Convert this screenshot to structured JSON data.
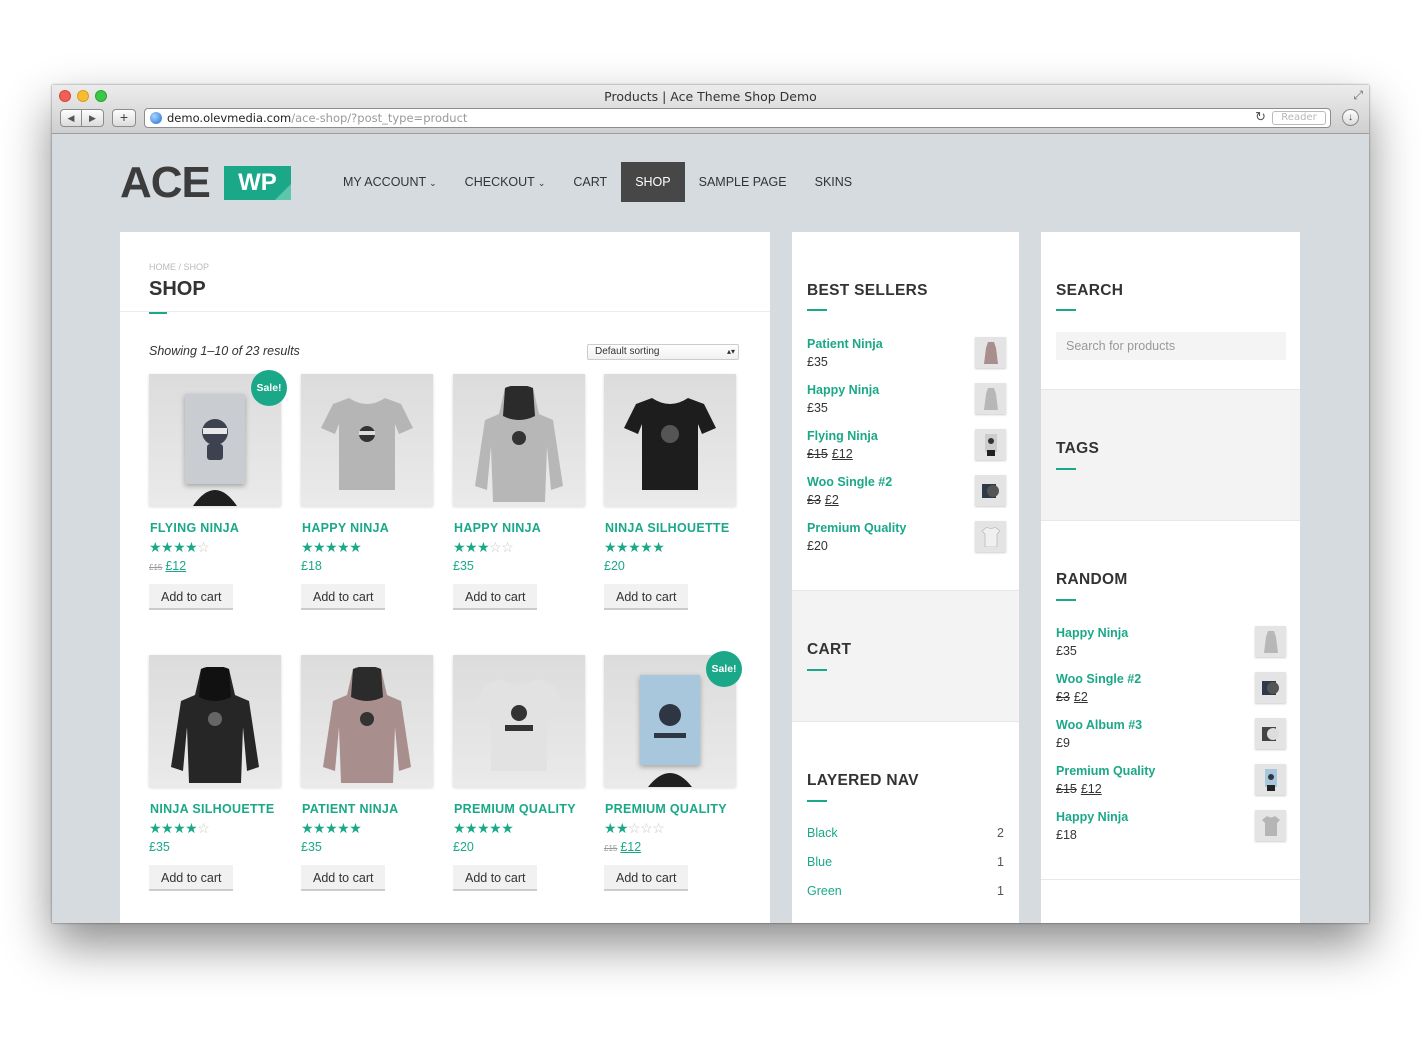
{
  "browser": {
    "window_title": "Products | Ace Theme Shop Demo",
    "url_host": "demo.olevmedia.com",
    "url_path": "/ace-shop/?post_type=product",
    "reader_label": "Reader",
    "back_icon": "◀",
    "forward_icon": "▶",
    "newtab_icon": "+",
    "reload_icon": "↻",
    "download_icon": "↓",
    "fullscreen_icon": "⤢"
  },
  "site": {
    "logo_ace": "ACE",
    "logo_wp": "WP",
    "accent_color": "#1ba889",
    "nav": [
      {
        "label": "MY ACCOUNT",
        "caret": "⌄"
      },
      {
        "label": "CHECKOUT",
        "caret": "⌄"
      },
      {
        "label": "CART"
      },
      {
        "label": "SHOP"
      },
      {
        "label": "SAMPLE PAGE"
      },
      {
        "label": "SKINS"
      }
    ]
  },
  "shop": {
    "breadcrumb": "HOME / SHOP",
    "title": "SHOP",
    "result_count": "Showing 1–10 of 23 results",
    "sort_selected": "Default sorting",
    "sale_badge": "Sale!",
    "add_to_cart": "Add to cart",
    "products": [
      {
        "name": "FLYING NINJA",
        "rating": 4,
        "old_price": "£15",
        "price": "£12",
        "sale": true,
        "kind": "poster",
        "color": "#c9ccd0"
      },
      {
        "name": "HAPPY NINJA",
        "rating": 5,
        "price": "£18",
        "kind": "tshirt",
        "color": "#b5b5b5"
      },
      {
        "name": "HAPPY NINJA",
        "rating": 3,
        "price": "£35",
        "kind": "hoodie",
        "color": "#b7b7b7"
      },
      {
        "name": "NINJA SILHOUETTE",
        "rating": 5,
        "price": "£20",
        "kind": "tshirt",
        "color": "#1d1d1d"
      },
      {
        "name": "NINJA SILHOUETTE",
        "rating": 4,
        "price": "£35",
        "kind": "hoodie",
        "color": "#262626"
      },
      {
        "name": "PATIENT NINJA",
        "rating": 4.5,
        "price": "£35",
        "kind": "hoodie",
        "color": "#a88f8d"
      },
      {
        "name": "PREMIUM QUALITY",
        "rating": 4.5,
        "price": "£20",
        "kind": "tshirt",
        "color": "#e2e2e2"
      },
      {
        "name": "PREMIUM QUALITY",
        "rating": 2,
        "old_price": "£15",
        "price": "£12",
        "sale": true,
        "kind": "poster",
        "color": "#a9c7dc"
      }
    ]
  },
  "best_sellers": {
    "title": "BEST SELLERS",
    "items": [
      {
        "name": "Patient Ninja",
        "price": "£35"
      },
      {
        "name": "Happy Ninja",
        "price": "£35"
      },
      {
        "name": "Flying Ninja",
        "old_price": "£15",
        "price": "£12"
      },
      {
        "name": "Woo Single #2",
        "old_price": "£3",
        "price": "£2"
      },
      {
        "name": "Premium Quality",
        "price": "£20"
      }
    ]
  },
  "cart_widget": {
    "title": "CART"
  },
  "layered_nav": {
    "title": "LAYERED NAV",
    "items": [
      {
        "label": "Black",
        "count": "2"
      },
      {
        "label": "Blue",
        "count": "1"
      },
      {
        "label": "Green",
        "count": "1"
      }
    ]
  },
  "search_widget": {
    "title": "SEARCH",
    "placeholder": "Search for products"
  },
  "tags_widget": {
    "title": "TAGS"
  },
  "random_widget": {
    "title": "RANDOM",
    "items": [
      {
        "name": "Happy Ninja",
        "price": "£35"
      },
      {
        "name": "Woo Single #2",
        "old_price": "£3",
        "price": "£2"
      },
      {
        "name": "Woo Album #3",
        "price": "£9"
      },
      {
        "name": "Premium Quality",
        "old_price": "£15",
        "price": "£12"
      },
      {
        "name": "Happy Ninja",
        "price": "£18"
      }
    ]
  }
}
